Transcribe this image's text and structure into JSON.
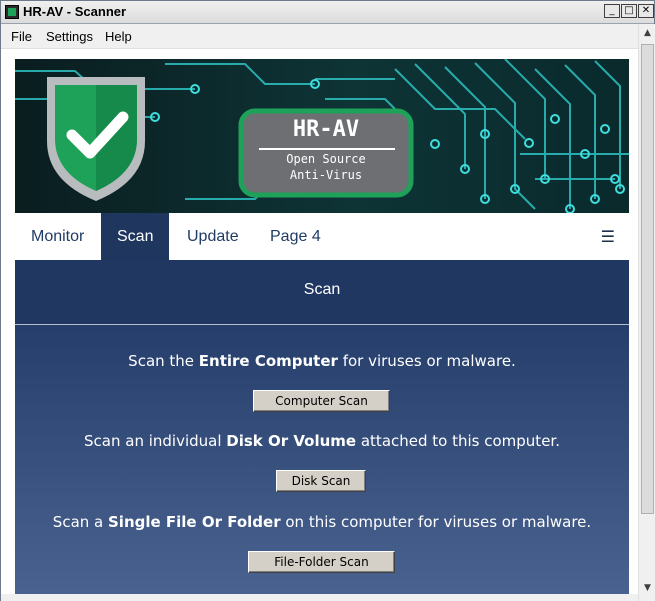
{
  "window": {
    "title": "HR-AV - Scanner",
    "controls": {
      "minimize": "_",
      "maximize": "□",
      "close": "✕"
    }
  },
  "menu": [
    {
      "label": "File"
    },
    {
      "label": "Settings"
    },
    {
      "label": "Help"
    }
  ],
  "banner": {
    "logo_title": "HR-AV",
    "logo_line1": "Open Source",
    "logo_line2": "Anti-Virus",
    "colors": {
      "accent": "#1ea25a",
      "circuit": "#2ec2c2",
      "background": "#0b2626"
    }
  },
  "tabs": [
    {
      "label": "Monitor",
      "active": false
    },
    {
      "label": "Scan",
      "active": true
    },
    {
      "label": "Update",
      "active": false
    },
    {
      "label": "Page 4",
      "active": false
    }
  ],
  "menu_icon": "☰",
  "section": {
    "title": "Scan",
    "items": [
      {
        "pre": "Scan the ",
        "bold": "Entire Computer",
        "post": " for viruses or malware.",
        "button": "Computer Scan"
      },
      {
        "pre": "Scan an individual ",
        "bold": "Disk Or Volume",
        "post": " attached to this computer.",
        "button": "Disk Scan"
      },
      {
        "pre": "Scan a ",
        "bold": "Single File Or Folder",
        "post": " on this computer for viruses or malware.",
        "button": "File-Folder Scan"
      }
    ]
  },
  "colors": {
    "nav_active": "#1f365f",
    "header": "#203762",
    "tab_text": "#1f3b66"
  },
  "icons": {
    "shield": "shield-check-icon",
    "scroll_up": "triangle-up-icon",
    "scroll_down": "triangle-down-icon"
  }
}
